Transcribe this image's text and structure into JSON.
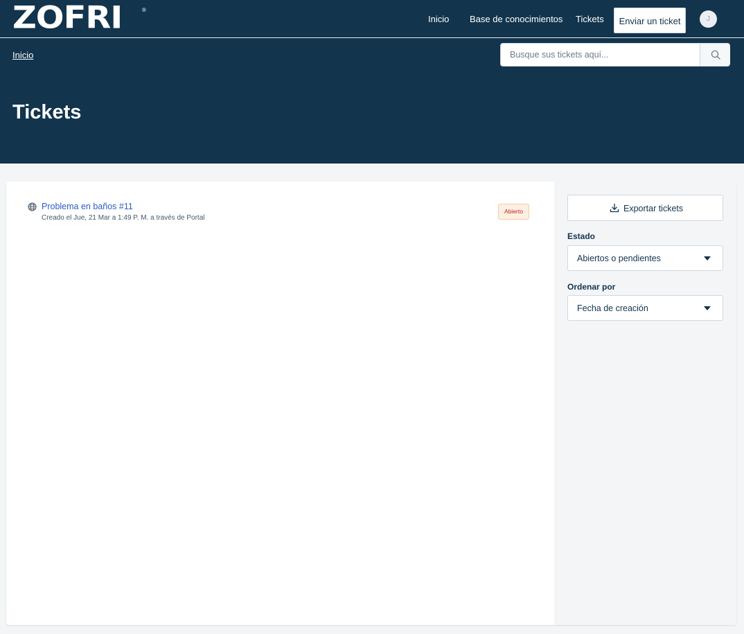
{
  "header": {
    "logo": "ZOFRI",
    "logo_mark": "®",
    "nav": {
      "inicio": "Inicio",
      "knowledge_base": "Base de conocimientos",
      "tickets": "Tickets",
      "submit_ticket": "Enviar un ticket"
    },
    "avatar_initial": "J",
    "breadcrumb": "Inicio",
    "search": {
      "placeholder": "Busque sus tickets aquí..."
    },
    "page_title": "Tickets"
  },
  "tickets": [
    {
      "title": "Problema en baños #11",
      "meta": "Creado el Jue, 21 Mar a 1:49 P. M. a través de Portal",
      "status": "Abierto",
      "icon": "globe-icon"
    }
  ],
  "sidebar": {
    "export_label": "Exportar tickets",
    "estado_label": "Estado",
    "estado_value": "Abiertos o pendientes",
    "orden_label": "Ordenar por",
    "orden_value": "Fecha de creación"
  },
  "colors": {
    "header_bg": "#12344d",
    "link": "#2c5cc5",
    "status_text": "#c82124",
    "status_bg": "#fdefe1"
  }
}
